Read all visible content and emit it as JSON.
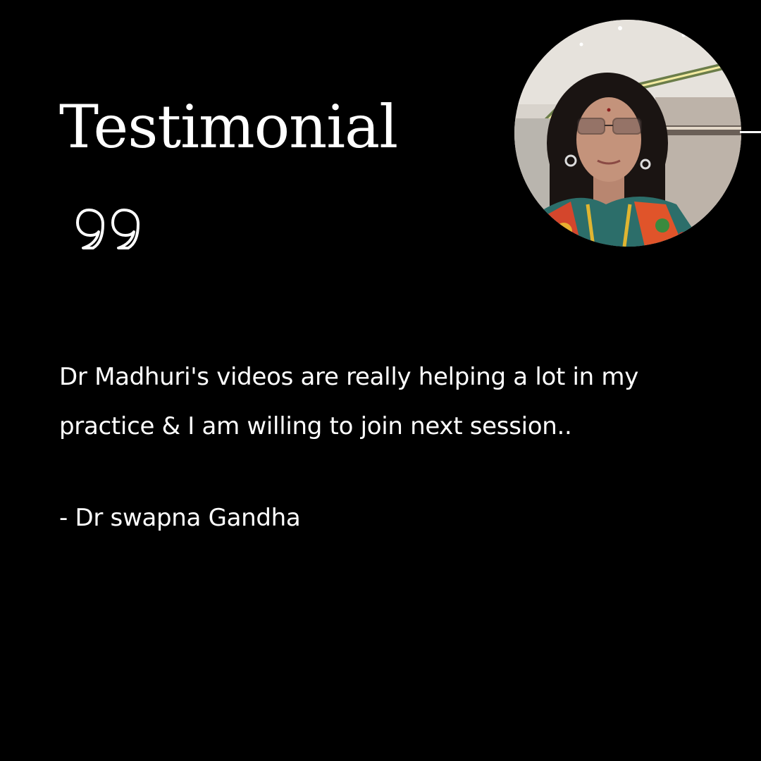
{
  "title": "Testimonial",
  "quote_icon": "quotation-marks-icon",
  "testimonial": {
    "text": "Dr Madhuri's videos are really helping a lot in my practice & I am willing to join next session..",
    "author": "- Dr swapna Gandha"
  },
  "colors": {
    "background": "#000000",
    "text": "#ffffff"
  }
}
